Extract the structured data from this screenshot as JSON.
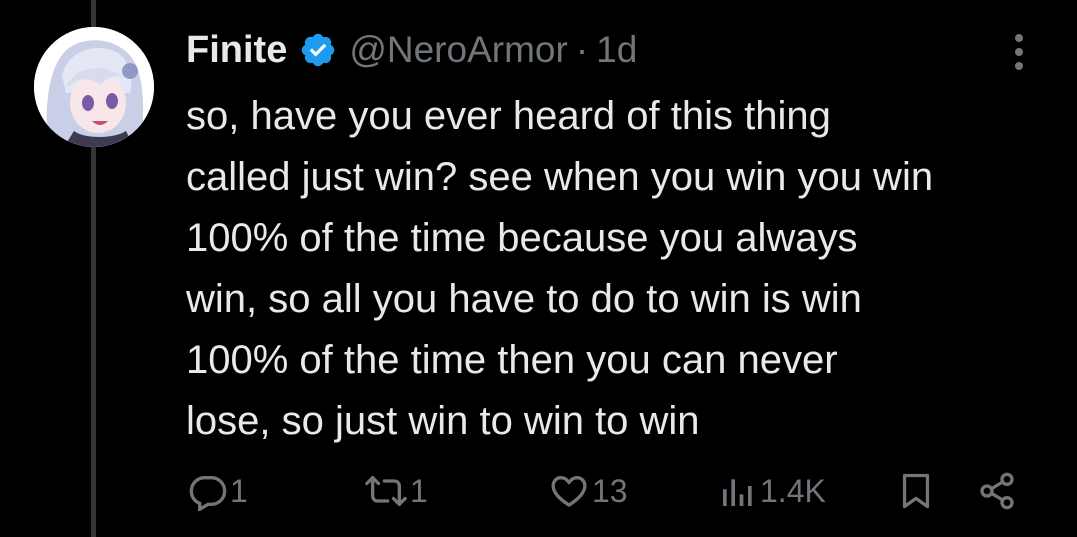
{
  "tweet": {
    "author": {
      "display_name": "Finite",
      "handle": "@NeroArmor",
      "verified": true,
      "avatar": "anime-character-avatar"
    },
    "separator": "·",
    "time": "1d",
    "text_lines": [
      "so, have you ever heard of this thing",
      "called just win? see when you win you win",
      "100% of the time because you always",
      "win, so all you have to do to win is win",
      "100% of the time then you can never",
      "lose, so just win to win to win"
    ],
    "actions": {
      "replies": {
        "icon": "reply-icon",
        "count": "1"
      },
      "reposts": {
        "icon": "repost-icon",
        "count": "1"
      },
      "likes": {
        "icon": "heart-icon",
        "count": "13"
      },
      "views": {
        "icon": "views-icon",
        "count": "1.4K"
      },
      "bookmark": {
        "icon": "bookmark-icon"
      },
      "share": {
        "icon": "share-icon"
      }
    },
    "menu": {
      "icon": "more-vertical-icon"
    }
  },
  "colors": {
    "background": "#000000",
    "text_primary": "#e7e9ea",
    "text_secondary": "#71767b",
    "verified_badge": "#1d9bf0",
    "thread_line": "#333639"
  }
}
